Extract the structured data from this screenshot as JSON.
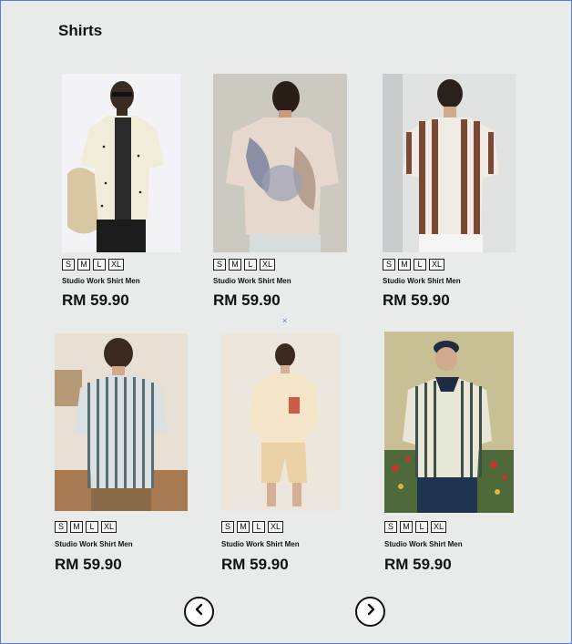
{
  "page": {
    "title": "Shirts"
  },
  "products": [
    {
      "name": "Studio Work Shirt Men",
      "price": "RM 59.90",
      "sizes": [
        "S",
        "M",
        "L",
        "XL"
      ]
    },
    {
      "name": "Studio Work Shirt Men",
      "price": "RM 59.90",
      "sizes": [
        "S",
        "M",
        "L",
        "XL"
      ]
    },
    {
      "name": "Studio Work Shirt Men",
      "price": "RM 59.90",
      "sizes": [
        "S",
        "M",
        "L",
        "XL"
      ]
    },
    {
      "name": "Studio Work Shirt Men",
      "price": "RM 59.90",
      "sizes": [
        "S",
        "M",
        "L",
        "XL"
      ]
    },
    {
      "name": "Studio Work Shirt Men",
      "price": "RM 59.90",
      "sizes": [
        "S",
        "M",
        "L",
        "XL"
      ]
    },
    {
      "name": "Studio Work Shirt Men",
      "price": "RM 59.90",
      "sizes": [
        "S",
        "M",
        "L",
        "XL"
      ]
    }
  ],
  "misc": {
    "marker": "×"
  },
  "icons": {
    "prev": "chevron-left-icon",
    "next": "chevron-right-icon"
  }
}
